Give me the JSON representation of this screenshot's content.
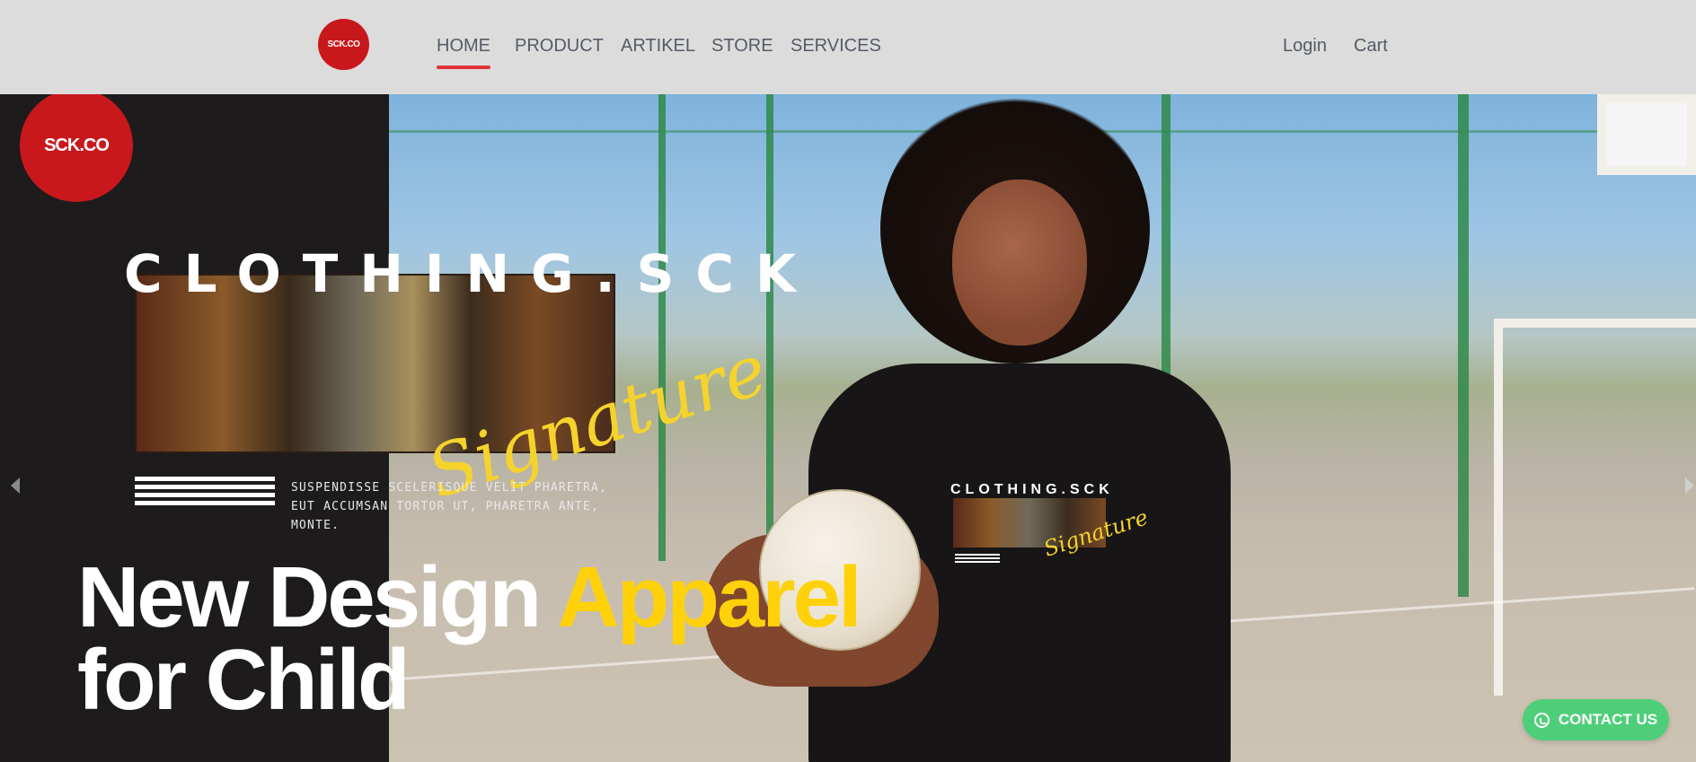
{
  "navbar": {
    "logo_text": "SCK.CO",
    "links": [
      "HOME",
      "PRODUCT",
      "ARTIKEL",
      "STORE",
      "SERVICES"
    ],
    "active_link": "HOME",
    "login_label": "Login",
    "cart_label": "Cart"
  },
  "hero": {
    "logo_text": "SCK.CO",
    "brand_title": "CLOTHING.SCK",
    "signature_text": "Signature",
    "tagline": "SUSPENDISSE SCELERISQUE VELIT PHARETRA, EUT ACCUMSAN TORTOR UT, PHARETRA ANTE, MONTE.",
    "headline_part1": "New Design ",
    "headline_accent": "Apparel",
    "headline_line2": "for Child",
    "shirt_print_title": "CLOTHING.SCK",
    "shirt_print_signature": "Signature"
  },
  "contact": {
    "label": "CONTACT US",
    "icon": "whatsapp-icon",
    "color": "#4fce7a"
  },
  "colors": {
    "navbar_bg": "#dcdcdc",
    "accent_red": "#e3343b",
    "brand_red": "#c8181c",
    "headline_yellow": "#ffd10a"
  }
}
